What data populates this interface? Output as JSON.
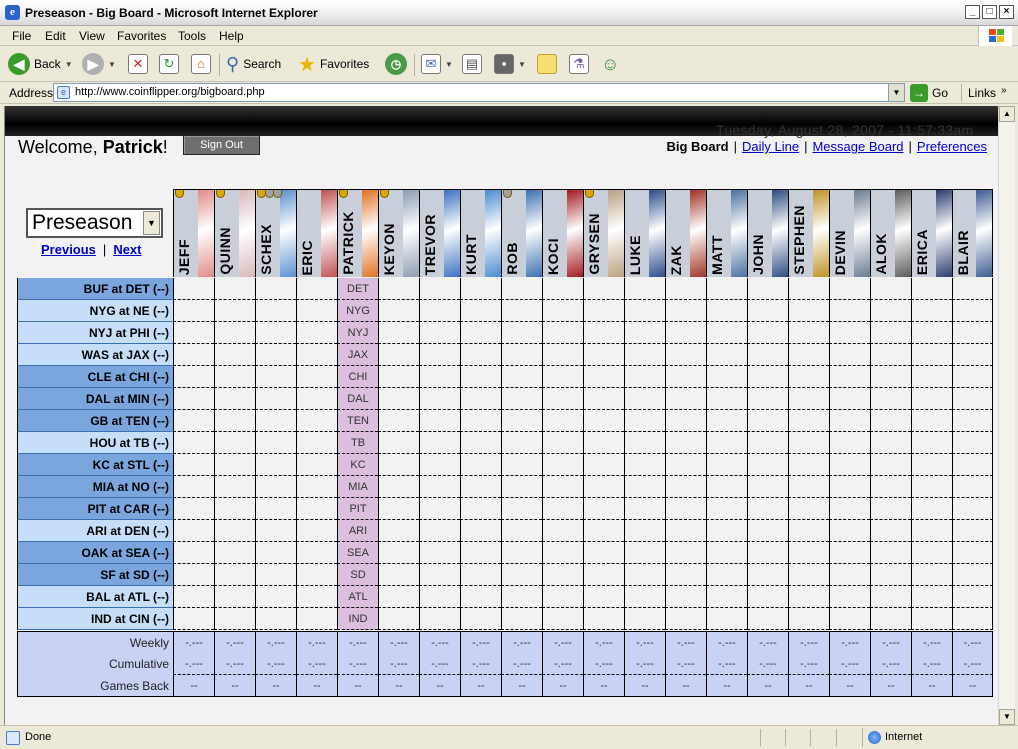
{
  "window": {
    "title": "Preseason - Big Board - Microsoft Internet Explorer",
    "minimize": "_",
    "maximize": "□",
    "close": "×"
  },
  "menu": [
    "File",
    "Edit",
    "View",
    "Favorites",
    "Tools",
    "Help"
  ],
  "toolbar": {
    "back_label": "Back",
    "search_label": "Search",
    "favorites_label": "Favorites"
  },
  "address": {
    "label": "Address",
    "url": "http://www.coinflipper.org/bigboard.php",
    "go_label": "Go",
    "links_label": "Links"
  },
  "header": {
    "datetime": "Tuesday, August 28, 2007 - 11:57:33am",
    "welcome_prefix": "Welcome, ",
    "username": "Patrick",
    "welcome_suffix": "!",
    "signout_label": "Sign Out"
  },
  "nav": {
    "current": "Big Board",
    "links": [
      "Daily Line",
      "Message Board",
      "Preferences"
    ]
  },
  "season": {
    "selected": "Preseason",
    "previous": "Previous",
    "next": "Next"
  },
  "players": [
    {
      "name": "JEFF",
      "art": "#e08a8a",
      "dots": [
        "#d8a800"
      ]
    },
    {
      "name": "QUINN",
      "art": "#d9b8b8",
      "dots": [
        "#d8a800"
      ]
    },
    {
      "name": "SCHEX",
      "art": "#5a8fd0",
      "dots": [
        "#d8a800",
        "#a0a0a0",
        "#a0a0a0"
      ]
    },
    {
      "name": "ERIC",
      "art": "#c05050",
      "dots": []
    },
    {
      "name": "PATRICK",
      "art": "#e07020",
      "dots": [
        "#d8a800"
      ]
    },
    {
      "name": "KEYON",
      "art": "#8a9ab0",
      "dots": [
        "#d8a800"
      ]
    },
    {
      "name": "TREVOR",
      "art": "#3a6fc0",
      "dots": []
    },
    {
      "name": "KURT",
      "art": "#4a8ad0",
      "dots": []
    },
    {
      "name": "ROB",
      "art": "#3a6fb0",
      "dots": [
        "#a0a0a0"
      ]
    },
    {
      "name": "KOCI",
      "art": "#a01820",
      "dots": []
    },
    {
      "name": "GRYSEN",
      "art": "#b8a080",
      "dots": [
        "#d8a800"
      ]
    },
    {
      "name": "LUKE",
      "art": "#2a4a8a",
      "dots": []
    },
    {
      "name": "ZAK",
      "art": "#a03020",
      "dots": []
    },
    {
      "name": "MATT",
      "art": "#4a6fa0",
      "dots": []
    },
    {
      "name": "JOHN",
      "art": "#2a4a80",
      "dots": []
    },
    {
      "name": "STEPHEN",
      "art": "#c09020",
      "dots": []
    },
    {
      "name": "DEVIN",
      "art": "#6a7a90",
      "dots": []
    },
    {
      "name": "ALOK",
      "art": "#5a5a5a",
      "dots": []
    },
    {
      "name": "ERICA",
      "art": "#2a3a70",
      "dots": []
    },
    {
      "name": "BLAIR",
      "art": "#3a5a90",
      "dots": []
    }
  ],
  "games": [
    {
      "label": "BUF at DET (--)",
      "color": "#7aa6dd",
      "pick": "DET"
    },
    {
      "label": "NYG at NE (--)",
      "color": "#c6def7",
      "pick": "NYG"
    },
    {
      "label": "NYJ at PHI (--)",
      "color": "#c6def7",
      "pick": "NYJ"
    },
    {
      "label": "WAS at JAX (--)",
      "color": "#c6def7",
      "pick": "JAX"
    },
    {
      "label": "CLE at CHI (--)",
      "color": "#7aa6dd",
      "pick": "CHI"
    },
    {
      "label": "DAL at MIN (--)",
      "color": "#7aa6dd",
      "pick": "DAL"
    },
    {
      "label": "GB at TEN (--)",
      "color": "#7aa6dd",
      "pick": "TEN"
    },
    {
      "label": "HOU at TB (--)",
      "color": "#c6def7",
      "pick": "TB"
    },
    {
      "label": "KC at STL (--)",
      "color": "#7aa6dd",
      "pick": "KC"
    },
    {
      "label": "MIA at NO (--)",
      "color": "#7aa6dd",
      "pick": "MIA"
    },
    {
      "label": "PIT at CAR (--)",
      "color": "#7aa6dd",
      "pick": "PIT"
    },
    {
      "label": "ARI at DEN (--)",
      "color": "#c6def7",
      "pick": "ARI"
    },
    {
      "label": "OAK at SEA (--)",
      "color": "#7aa6dd",
      "pick": "SEA"
    },
    {
      "label": "SF at SD (--)",
      "color": "#7aa6dd",
      "pick": "SD"
    },
    {
      "label": "BAL at ATL (--)",
      "color": "#c6def7",
      "pick": "ATL"
    },
    {
      "label": "IND at CIN (--)",
      "color": "#c6def7",
      "pick": "IND"
    }
  ],
  "current_player_index": 4,
  "stats": [
    {
      "label": "Weekly",
      "value": "-.---"
    },
    {
      "label": "Cumulative",
      "value": "-.---"
    },
    {
      "label": "Games Back",
      "value": "--"
    }
  ],
  "status": {
    "text": "Done",
    "zone": "Internet"
  }
}
